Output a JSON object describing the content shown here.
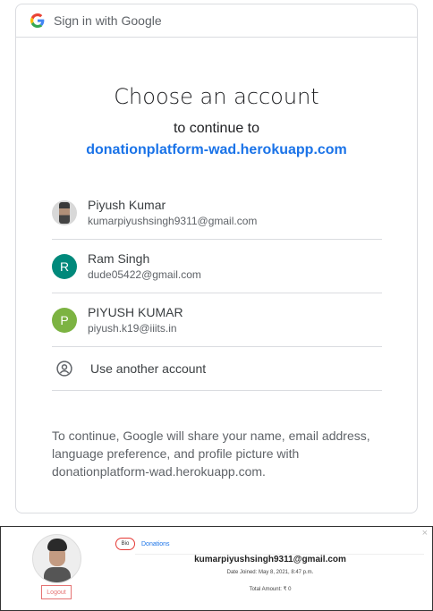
{
  "header": {
    "label": "Sign in with Google"
  },
  "chooser": {
    "title": "Choose an account",
    "subtitle": "to continue to",
    "app_domain": "donationplatform-wad.herokuapp.com"
  },
  "accounts": [
    {
      "name": "Piyush Kumar",
      "email": "kumarpiyushsingh9311@gmail.com",
      "avatar": "photo"
    },
    {
      "name": "Ram Singh",
      "email": "dude05422@gmail.com",
      "avatar_letter": "R",
      "avatar_color": "#00897b"
    },
    {
      "name": "PIYUSH KUMAR",
      "email": "piyush.k19@iiits.in",
      "avatar_letter": "P",
      "avatar_color": "#7cb342"
    }
  ],
  "use_another": {
    "label": "Use another account",
    "icon": "account-circle-icon"
  },
  "disclaimer": "To continue, Google will share your name, email address, language preference, and profile picture with donationplatform-wad.herokuapp.com.",
  "profile": {
    "close_glyph": "×",
    "logout_label": "Logout",
    "tab_bio": "Bio",
    "tab_donations": "Donations",
    "email": "kumarpiyushsingh9311@gmail.com",
    "date_joined": "Date Joined: May 8, 2021, 8:47 p.m.",
    "total_amount": "Total Amount: ₹ 0"
  },
  "colors": {
    "link": "#1a73e8",
    "border": "#dadce0",
    "logout": "#e57373"
  }
}
